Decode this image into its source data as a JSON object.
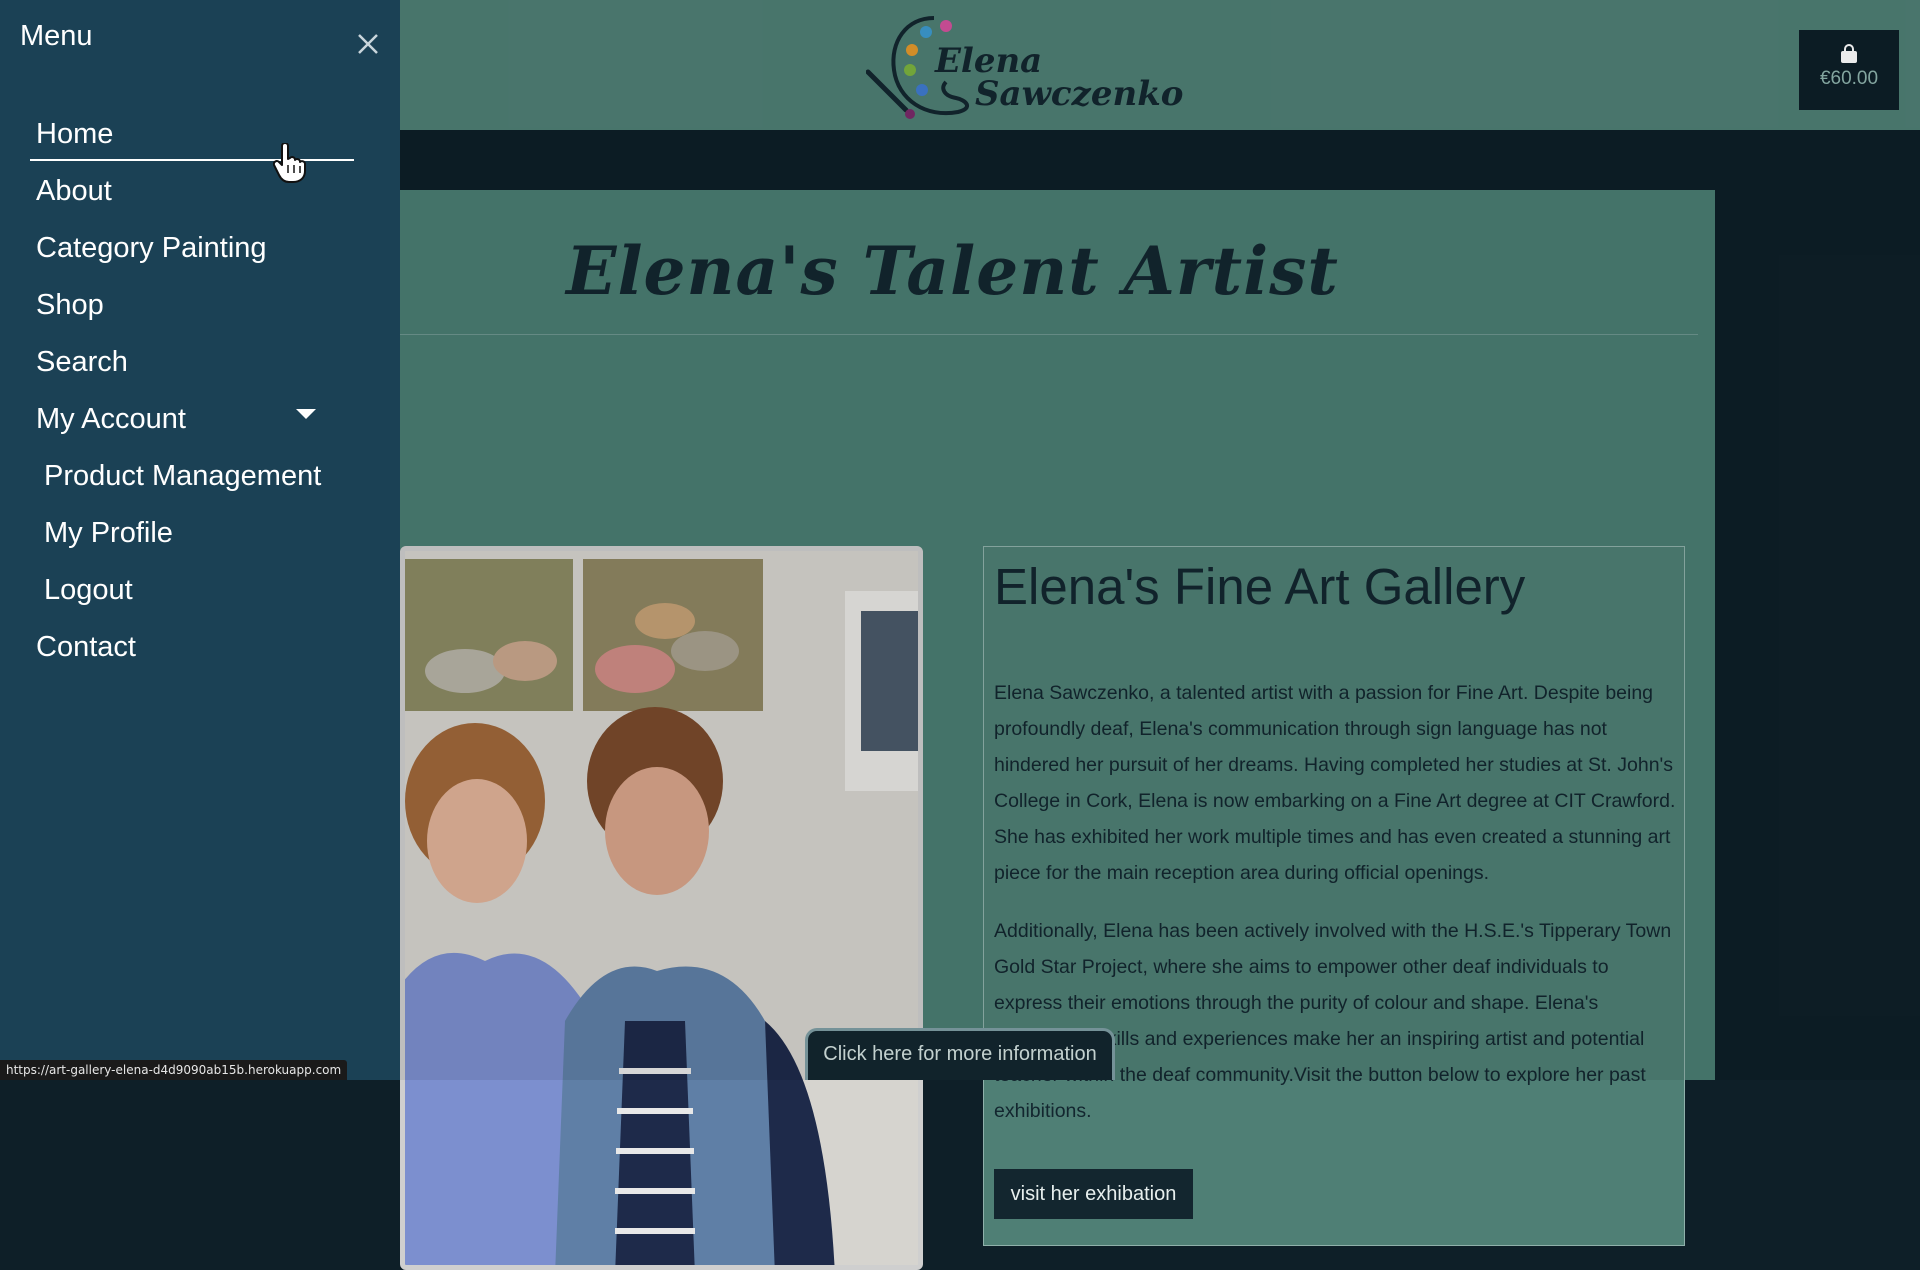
{
  "header": {
    "logo_first": "Elena",
    "logo_last": "Sawczenko",
    "cart_total": "€60.00",
    "cart_icon": "shopping-bag-icon"
  },
  "main": {
    "title": "Elena's Talent Artist",
    "card_title": "Elena's Fine Art Gallery",
    "paragraph1": "Elena Sawczenko, a talented artist with a passion for Fine Art. Despite being profoundly deaf, Elena's communication through sign language has not hindered her pursuit of her dreams. Having completed her studies at St. John's College in Cork, Elena is now embarking on a Fine Art degree at CIT Crawford. She has exhibited her work multiple times and has even created a stunning art piece for the main reception area during official openings.",
    "paragraph2": "Additionally, Elena has been actively involved with the H.S.E.'s Tipperary Town Gold Star Project, where she aims to empower other deaf individuals to express their emotions through the purity of colour and shape. Elena's remarkable skills and experiences make her an inspiring artist and potential teacher within the deaf community.Visit the button below to explore her past exhibitions.",
    "exhibition_button": "visit her exhibation",
    "info_tab": "Click here for more information"
  },
  "drawer": {
    "title": "Menu",
    "close_icon": "close-icon",
    "items": [
      {
        "label": "Home"
      },
      {
        "label": "About"
      },
      {
        "label": "Category Painting"
      },
      {
        "label": "Shop"
      },
      {
        "label": "Search"
      },
      {
        "label": "My Account"
      },
      {
        "label": "Product Management"
      },
      {
        "label": "My Profile"
      },
      {
        "label": "Logout"
      },
      {
        "label": "Contact"
      }
    ]
  },
  "status_bar": {
    "url": "https://art-gallery-elena-d4d9090ab15b.herokuapp.com"
  },
  "colors": {
    "header_bg": "#4f7f75",
    "drawer_bg": "#1b4155",
    "dark_navy": "#0e1f28",
    "text_dark": "#13262f"
  }
}
